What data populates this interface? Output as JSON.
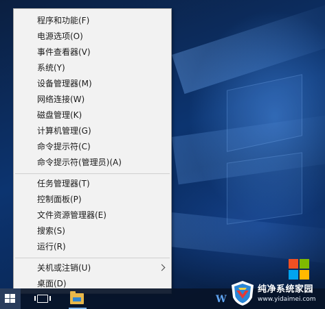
{
  "context_menu": {
    "groups": [
      [
        "程序和功能(F)",
        "电源选项(O)",
        "事件查看器(V)",
        "系统(Y)",
        "设备管理器(M)",
        "网络连接(W)",
        "磁盘管理(K)",
        "计算机管理(G)",
        "命令提示符(C)",
        "命令提示符(管理员)(A)"
      ],
      [
        "任务管理器(T)",
        "控制面板(P)",
        "文件资源管理器(E)",
        "搜索(S)",
        "运行(R)"
      ],
      [
        "关机或注销(U)",
        "桌面(D)"
      ]
    ]
  },
  "taskbar": {
    "start_icon": "windows-logo-icon",
    "task_view_icon": "task-view-icon",
    "explorer_icon": "file-explorer-icon",
    "partial_text": "W"
  },
  "watermark": {
    "title": "纯净系统家园",
    "url": "www.yidaimei.com"
  },
  "colors": {
    "menu_bg": "#f2f2f2",
    "menu_border": "#a0a0a0",
    "taskbar_bg": "#08142a",
    "ms_red": "#f25022",
    "ms_green": "#7fba00",
    "ms_blue": "#00a4ef",
    "ms_yellow": "#ffb900"
  }
}
